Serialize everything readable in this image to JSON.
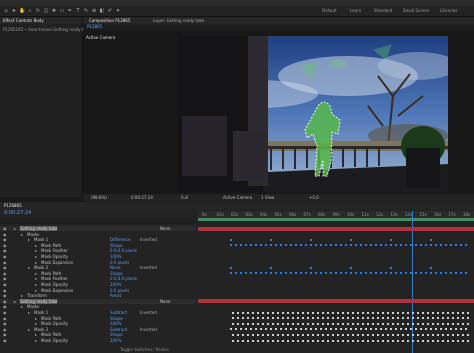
{
  "menu": [
    "File",
    "Edit",
    "Composition",
    "Layer",
    "Effect",
    "Animation",
    "View",
    "Window",
    "Help"
  ],
  "workspaces": [
    "Default",
    "Learn",
    "Standard",
    "Small Screen",
    "Libraries"
  ],
  "panels": {
    "left_tab": "Effect Controls Body",
    "comp_tab": "Composition P12865",
    "layer_tab": "Layer: Getting ready take"
  },
  "left": {
    "breadcrumb": "P1265145 • Auto-traced Getting ready tak",
    "comp_name": "P12865",
    "camera_label": "Active Camera"
  },
  "viewer_controls": {
    "zoom": "(98.8%)",
    "timecode": "0:00:27:24",
    "resolution": "Full",
    "camera": "Active Camera",
    "views": "1 View",
    "offset": "+0.0"
  },
  "timeline": {
    "tab": "P126865",
    "timecode": "0:00:27:24",
    "ruler": [
      "0s",
      "01s",
      "02s",
      "03s",
      "04s",
      "05s",
      "06s",
      "07s",
      "08s",
      "09s",
      "10s",
      "11s",
      "12s",
      "13s",
      "14s",
      "15s",
      "16s",
      "17s",
      "18s"
    ],
    "footer": "Toggle Switches / Modes"
  },
  "layers": [
    {
      "indent": 0,
      "name": "Getting ready take",
      "mode": "None",
      "track": "red"
    },
    {
      "indent": 1,
      "name": "Masks",
      "value": "",
      "track": "none"
    },
    {
      "indent": 2,
      "name": "Mask 1",
      "value": "Difference",
      "extra": "Inverted",
      "track": "blue"
    },
    {
      "indent": 3,
      "name": "Mask Path",
      "value": "Shape",
      "track": "blue"
    },
    {
      "indent": 3,
      "name": "Mask Feather",
      "value": "0.0,0.0 pixels",
      "track": "none"
    },
    {
      "indent": 3,
      "name": "Mask Opacity",
      "value": "100%",
      "track": "none"
    },
    {
      "indent": 3,
      "name": "Mask Expansion",
      "value": "0.0 pixels",
      "track": "none"
    },
    {
      "indent": 2,
      "name": "Mask 2",
      "value": "None",
      "extra": "Inverted",
      "track": "blue"
    },
    {
      "indent": 3,
      "name": "Mask Path",
      "value": "Shape",
      "track": "blue"
    },
    {
      "indent": 3,
      "name": "Mask Feather",
      "value": "0.0,0.0 pixels",
      "track": "none"
    },
    {
      "indent": 3,
      "name": "Mask Opacity",
      "value": "100%",
      "track": "none"
    },
    {
      "indent": 3,
      "name": "Mask Expansion",
      "value": "0.0 pixels",
      "track": "none"
    },
    {
      "indent": 1,
      "name": "Transform",
      "value": "Reset",
      "track": "none"
    },
    {
      "indent": 0,
      "name": "Getting ready take",
      "mode": "None",
      "track": "red"
    },
    {
      "indent": 1,
      "name": "Masks",
      "value": "",
      "track": "none"
    },
    {
      "indent": 2,
      "name": "Mask 1",
      "value": "Subtract",
      "extra": "Inverted",
      "track": "white"
    },
    {
      "indent": 3,
      "name": "Mask Path",
      "value": "Shape",
      "track": "white"
    },
    {
      "indent": 3,
      "name": "Mask Opacity",
      "value": "100%",
      "track": "white"
    },
    {
      "indent": 2,
      "name": "Mask 2",
      "value": "Subtract",
      "extra": "Inverted",
      "track": "white"
    },
    {
      "indent": 3,
      "name": "Mask Path",
      "value": "Shape",
      "track": "white"
    },
    {
      "indent": 3,
      "name": "Mask Opacity",
      "value": "100%",
      "track": "white"
    }
  ],
  "colors": {
    "accent": "#2f7bd6",
    "layer_bar": "#a8353b",
    "work_area": "#4b8a5e"
  }
}
